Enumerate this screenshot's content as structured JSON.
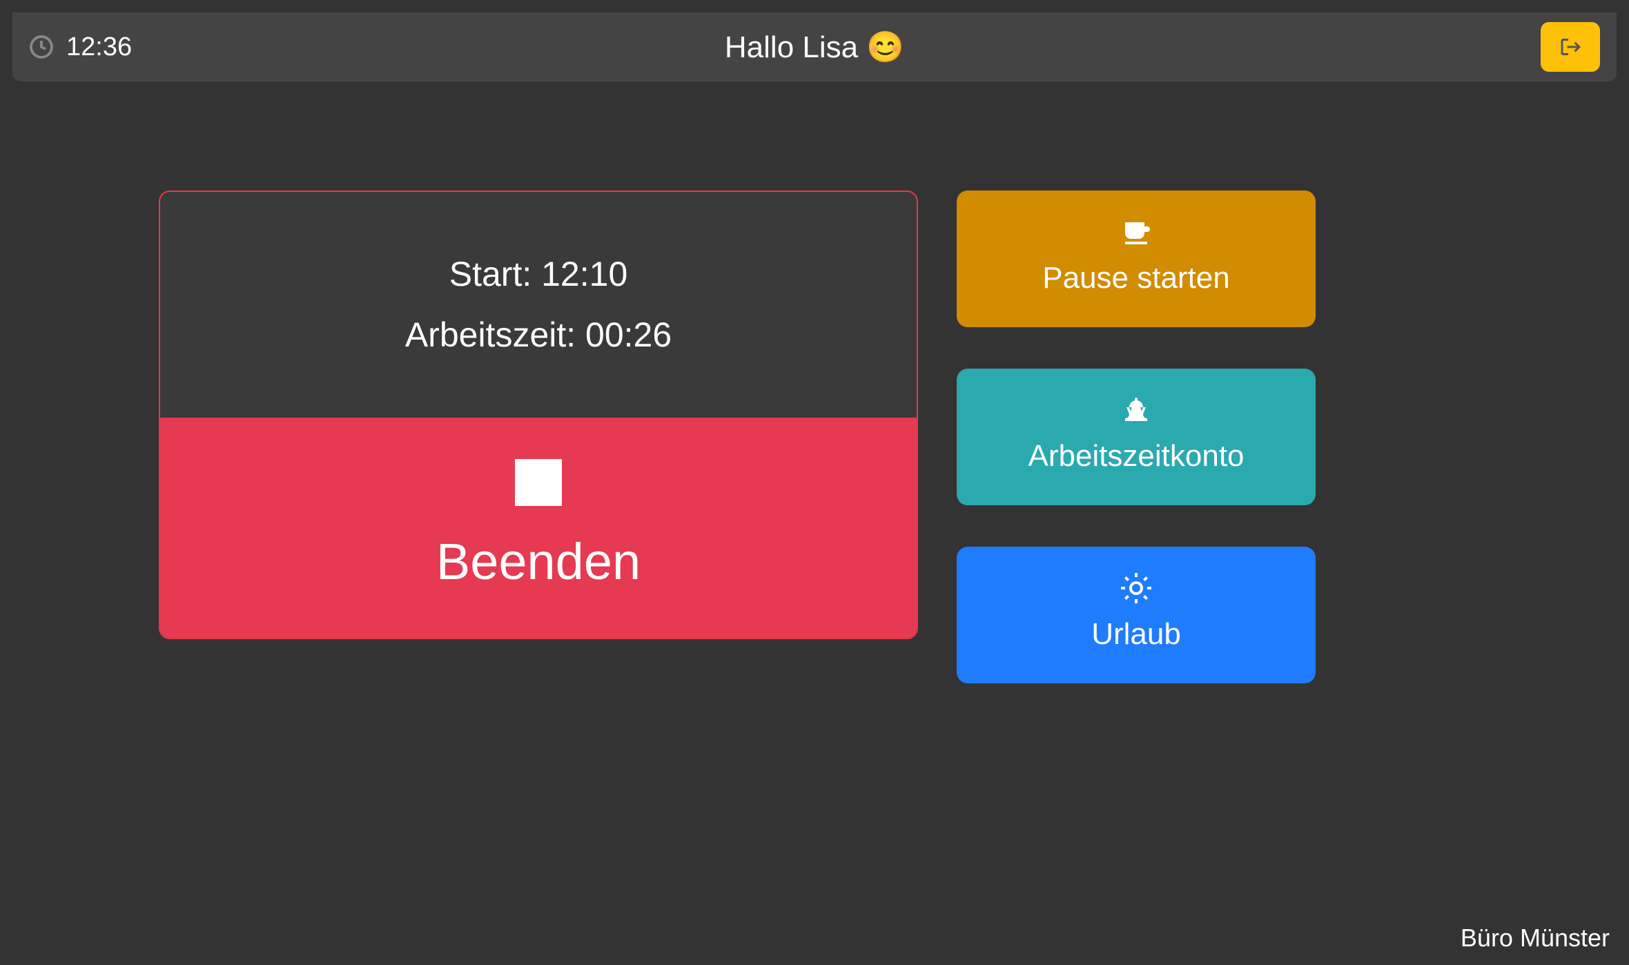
{
  "header": {
    "time": "12:36",
    "greeting": "Hallo Lisa 😊"
  },
  "session": {
    "start_label": "Start: 12:10",
    "work_label": "Arbeitszeit: 00:26"
  },
  "buttons": {
    "end": "Beenden",
    "pause": "Pause starten",
    "account": "Arbeitszeitkonto",
    "vacation": "Urlaub"
  },
  "footer": {
    "location": "Büro Münster"
  }
}
